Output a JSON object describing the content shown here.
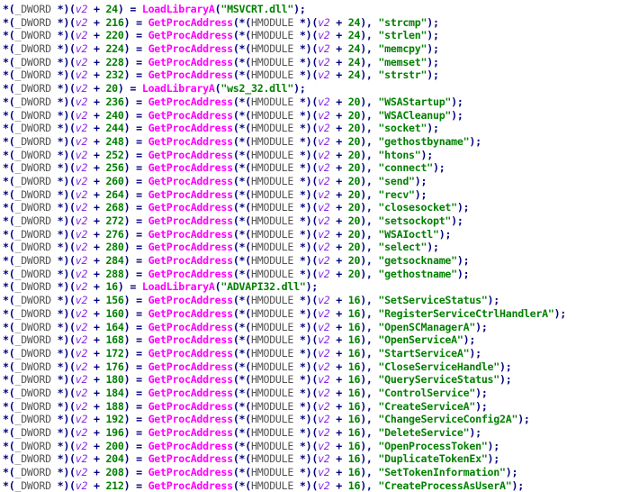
{
  "code_lines": [
    {
      "kind": "load",
      "offset": "24",
      "lib": "\"MSVCRT.dll\""
    },
    {
      "kind": "proc",
      "offset": "216",
      "handle": "24",
      "name": "\"strcmp\""
    },
    {
      "kind": "proc",
      "offset": "220",
      "handle": "24",
      "name": "\"strlen\""
    },
    {
      "kind": "proc",
      "offset": "224",
      "handle": "24",
      "name": "\"memcpy\""
    },
    {
      "kind": "proc",
      "offset": "228",
      "handle": "24",
      "name": "\"memset\""
    },
    {
      "kind": "proc",
      "offset": "232",
      "handle": "24",
      "name": "\"strstr\""
    },
    {
      "kind": "load",
      "offset": "20",
      "lib": "\"ws2_32.dll\""
    },
    {
      "kind": "proc",
      "offset": "236",
      "handle": "20",
      "name": "\"WSAStartup\""
    },
    {
      "kind": "proc",
      "offset": "240",
      "handle": "20",
      "name": "\"WSACleanup\""
    },
    {
      "kind": "proc",
      "offset": "244",
      "handle": "20",
      "name": "\"socket\""
    },
    {
      "kind": "proc",
      "offset": "248",
      "handle": "20",
      "name": "\"gethostbyname\""
    },
    {
      "kind": "proc",
      "offset": "252",
      "handle": "20",
      "name": "\"htons\""
    },
    {
      "kind": "proc",
      "offset": "256",
      "handle": "20",
      "name": "\"connect\""
    },
    {
      "kind": "proc",
      "offset": "260",
      "handle": "20",
      "name": "\"send\""
    },
    {
      "kind": "proc",
      "offset": "264",
      "handle": "20",
      "name": "\"recv\""
    },
    {
      "kind": "proc",
      "offset": "268",
      "handle": "20",
      "name": "\"closesocket\""
    },
    {
      "kind": "proc",
      "offset": "272",
      "handle": "20",
      "name": "\"setsockopt\""
    },
    {
      "kind": "proc",
      "offset": "276",
      "handle": "20",
      "name": "\"WSAIoctl\""
    },
    {
      "kind": "proc",
      "offset": "280",
      "handle": "20",
      "name": "\"select\""
    },
    {
      "kind": "proc",
      "offset": "284",
      "handle": "20",
      "name": "\"getsockname\""
    },
    {
      "kind": "proc",
      "offset": "288",
      "handle": "20",
      "name": "\"gethostname\""
    },
    {
      "kind": "load",
      "offset": "16",
      "lib": "\"ADVAPI32.dll\""
    },
    {
      "kind": "proc",
      "offset": "156",
      "handle": "16",
      "name": "\"SetServiceStatus\""
    },
    {
      "kind": "proc",
      "offset": "160",
      "handle": "16",
      "name": "\"RegisterServiceCtrlHandlerA\""
    },
    {
      "kind": "proc",
      "offset": "164",
      "handle": "16",
      "name": "\"OpenSCManagerA\""
    },
    {
      "kind": "proc",
      "offset": "168",
      "handle": "16",
      "name": "\"OpenServiceA\""
    },
    {
      "kind": "proc",
      "offset": "172",
      "handle": "16",
      "name": "\"StartServiceA\""
    },
    {
      "kind": "proc",
      "offset": "176",
      "handle": "16",
      "name": "\"CloseServiceHandle\""
    },
    {
      "kind": "proc",
      "offset": "180",
      "handle": "16",
      "name": "\"QueryServiceStatus\""
    },
    {
      "kind": "proc",
      "offset": "184",
      "handle": "16",
      "name": "\"ControlService\""
    },
    {
      "kind": "proc",
      "offset": "188",
      "handle": "16",
      "name": "\"CreateServiceA\""
    },
    {
      "kind": "proc",
      "offset": "192",
      "handle": "16",
      "name": "\"ChangeServiceConfig2A\""
    },
    {
      "kind": "proc",
      "offset": "196",
      "handle": "16",
      "name": "\"DeleteService\""
    },
    {
      "kind": "proc",
      "offset": "200",
      "handle": "16",
      "name": "\"OpenProcessToken\""
    },
    {
      "kind": "proc",
      "offset": "204",
      "handle": "16",
      "name": "\"DuplicateTokenEx\""
    },
    {
      "kind": "proc",
      "offset": "208",
      "handle": "16",
      "name": "\"SetTokenInformation\""
    },
    {
      "kind": "proc",
      "offset": "212",
      "handle": "16",
      "name": "\"CreateProcessAsUserA\""
    }
  ],
  "tokens": {
    "deref": "*(",
    "dword": "_DWORD",
    "ptr_close": " *)(",
    "var": "v2",
    "plus": " + ",
    "assign": ") = ",
    "load_func": "LoadLibraryA",
    "proc_func": "GetProcAddress",
    "hmodule": "HMODULE",
    "open_paren": "(",
    "proc_mid": "(*(",
    "close_args": "), ",
    "end": ");"
  }
}
